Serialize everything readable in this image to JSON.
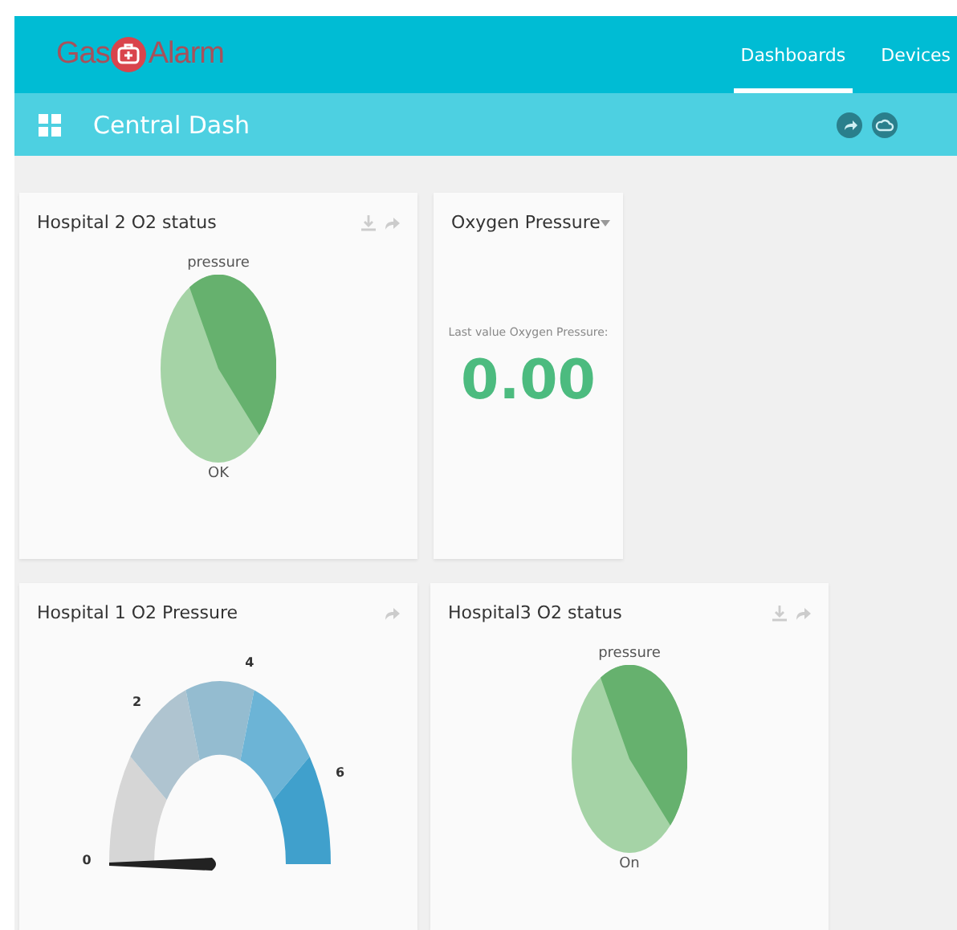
{
  "header": {
    "logo_left": "Gas",
    "logo_right": "Alarm",
    "nav": [
      {
        "label": "Dashboards",
        "selected": true
      },
      {
        "label": "Devices",
        "selected": false
      }
    ]
  },
  "toolbar": {
    "title": "Central Dash"
  },
  "widgets": [
    {
      "kind": "pie",
      "title": "Hospital 2 O2 status",
      "top_label": "pressure",
      "bottom_label": "OK",
      "download": true
    },
    {
      "kind": "value",
      "title": "Oxygen Pressure",
      "caption": "Last value Oxygen Pressure:",
      "value": "0.00"
    },
    {
      "kind": "gauge",
      "title": "Hospital 1 O2 Pressure",
      "ticks": [
        "0",
        "2",
        "4",
        "6"
      ],
      "download": false
    },
    {
      "kind": "pie",
      "title": "Hospital3 O2 status",
      "top_label": "pressure",
      "bottom_label": "On",
      "download": true
    }
  ]
}
